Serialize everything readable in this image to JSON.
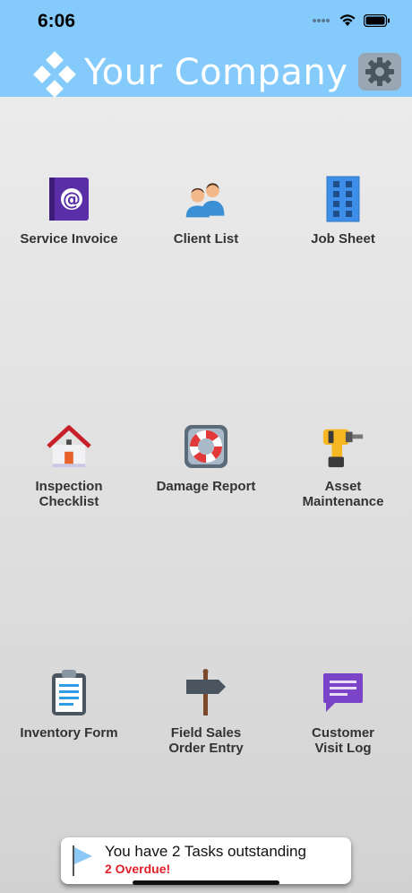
{
  "status_bar": {
    "time": "6:06"
  },
  "header": {
    "company_name": "Your Company",
    "logo_icon": "diamond-logo-icon",
    "settings_icon": "gear-icon"
  },
  "colors": {
    "header_bg": "#84cafb",
    "overdue": "#e0202a"
  },
  "tiles": [
    {
      "label": "Service Invoice",
      "icon": "email-at-book-icon"
    },
    {
      "label": "Client List",
      "icon": "people-icon"
    },
    {
      "label": "Job Sheet",
      "icon": "building-icon"
    },
    {
      "label": "Inspection\nChecklist",
      "icon": "house-icon"
    },
    {
      "label": "Damage Report",
      "icon": "lifebuoy-icon"
    },
    {
      "label": "Asset\nMaintenance",
      "icon": "drill-icon"
    },
    {
      "label": "Inventory Form",
      "icon": "clipboard-icon"
    },
    {
      "label": "Field Sales\nOrder Entry",
      "icon": "signpost-icon"
    },
    {
      "label": "Customer\nVisit Log",
      "icon": "chat-bubble-icon"
    }
  ],
  "task_banner": {
    "title": "You have 2 Tasks outstanding",
    "overdue": "2 Overdue!",
    "icon": "flag-icon"
  }
}
